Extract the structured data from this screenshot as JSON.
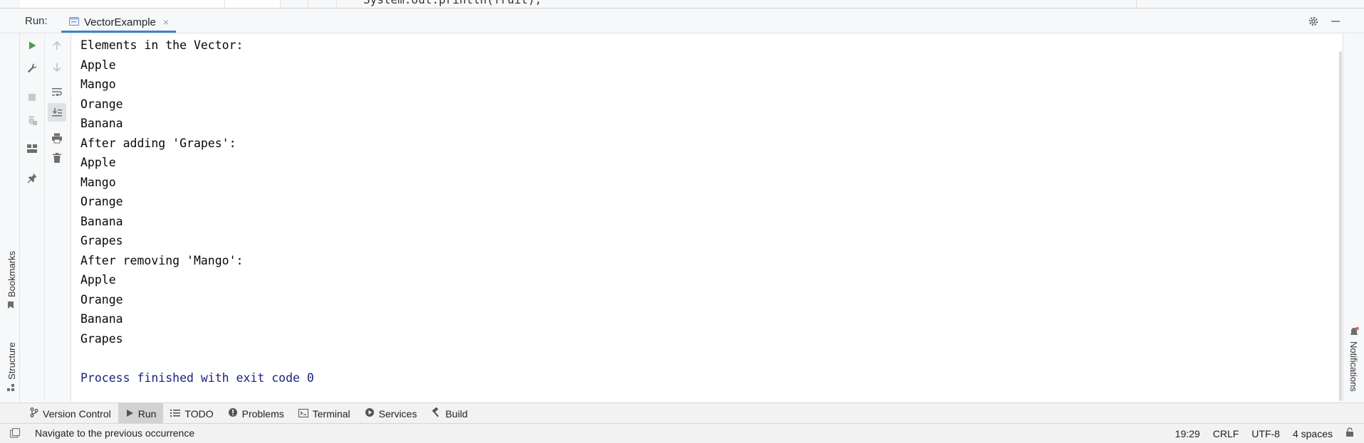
{
  "editor": {
    "code_fragment": "System.out.println(fruit);"
  },
  "run_panel": {
    "label": "Run:",
    "tab_title": "VectorExample",
    "tab_close": "×"
  },
  "left_strip": {
    "bookmarks": "Bookmarks",
    "structure": "Structure"
  },
  "right_strip": {
    "notifications": "Notifications"
  },
  "console": {
    "lines": [
      "Elements in the Vector:",
      "Apple",
      "Mango",
      "Orange",
      "Banana",
      "After adding 'Grapes':",
      "Apple",
      "Mango",
      "Orange",
      "Banana",
      "Grapes",
      "After removing 'Mango':",
      "Apple",
      "Orange",
      "Banana",
      "Grapes",
      "",
      "Process finished with exit code 0"
    ]
  },
  "tool_tabs": [
    {
      "label": "Version Control",
      "icon": "branch-icon",
      "active": false
    },
    {
      "label": "Run",
      "icon": "play-icon",
      "active": true
    },
    {
      "label": "TODO",
      "icon": "list-icon",
      "active": false
    },
    {
      "label": "Problems",
      "icon": "info-icon",
      "active": false
    },
    {
      "label": "Terminal",
      "icon": "terminal-icon",
      "active": false
    },
    {
      "label": "Services",
      "icon": "services-icon",
      "active": false
    },
    {
      "label": "Build",
      "icon": "hammer-icon",
      "active": false
    }
  ],
  "status": {
    "message": "Navigate to the previous occurrence",
    "position": "19:29",
    "line_ending": "CRLF",
    "encoding": "UTF-8",
    "indent": "4 spaces"
  },
  "colors": {
    "accent": "#4083c9",
    "run_green": "#499c54",
    "finish_text": "#1a237e",
    "icon_gray": "#6e6e6e"
  }
}
